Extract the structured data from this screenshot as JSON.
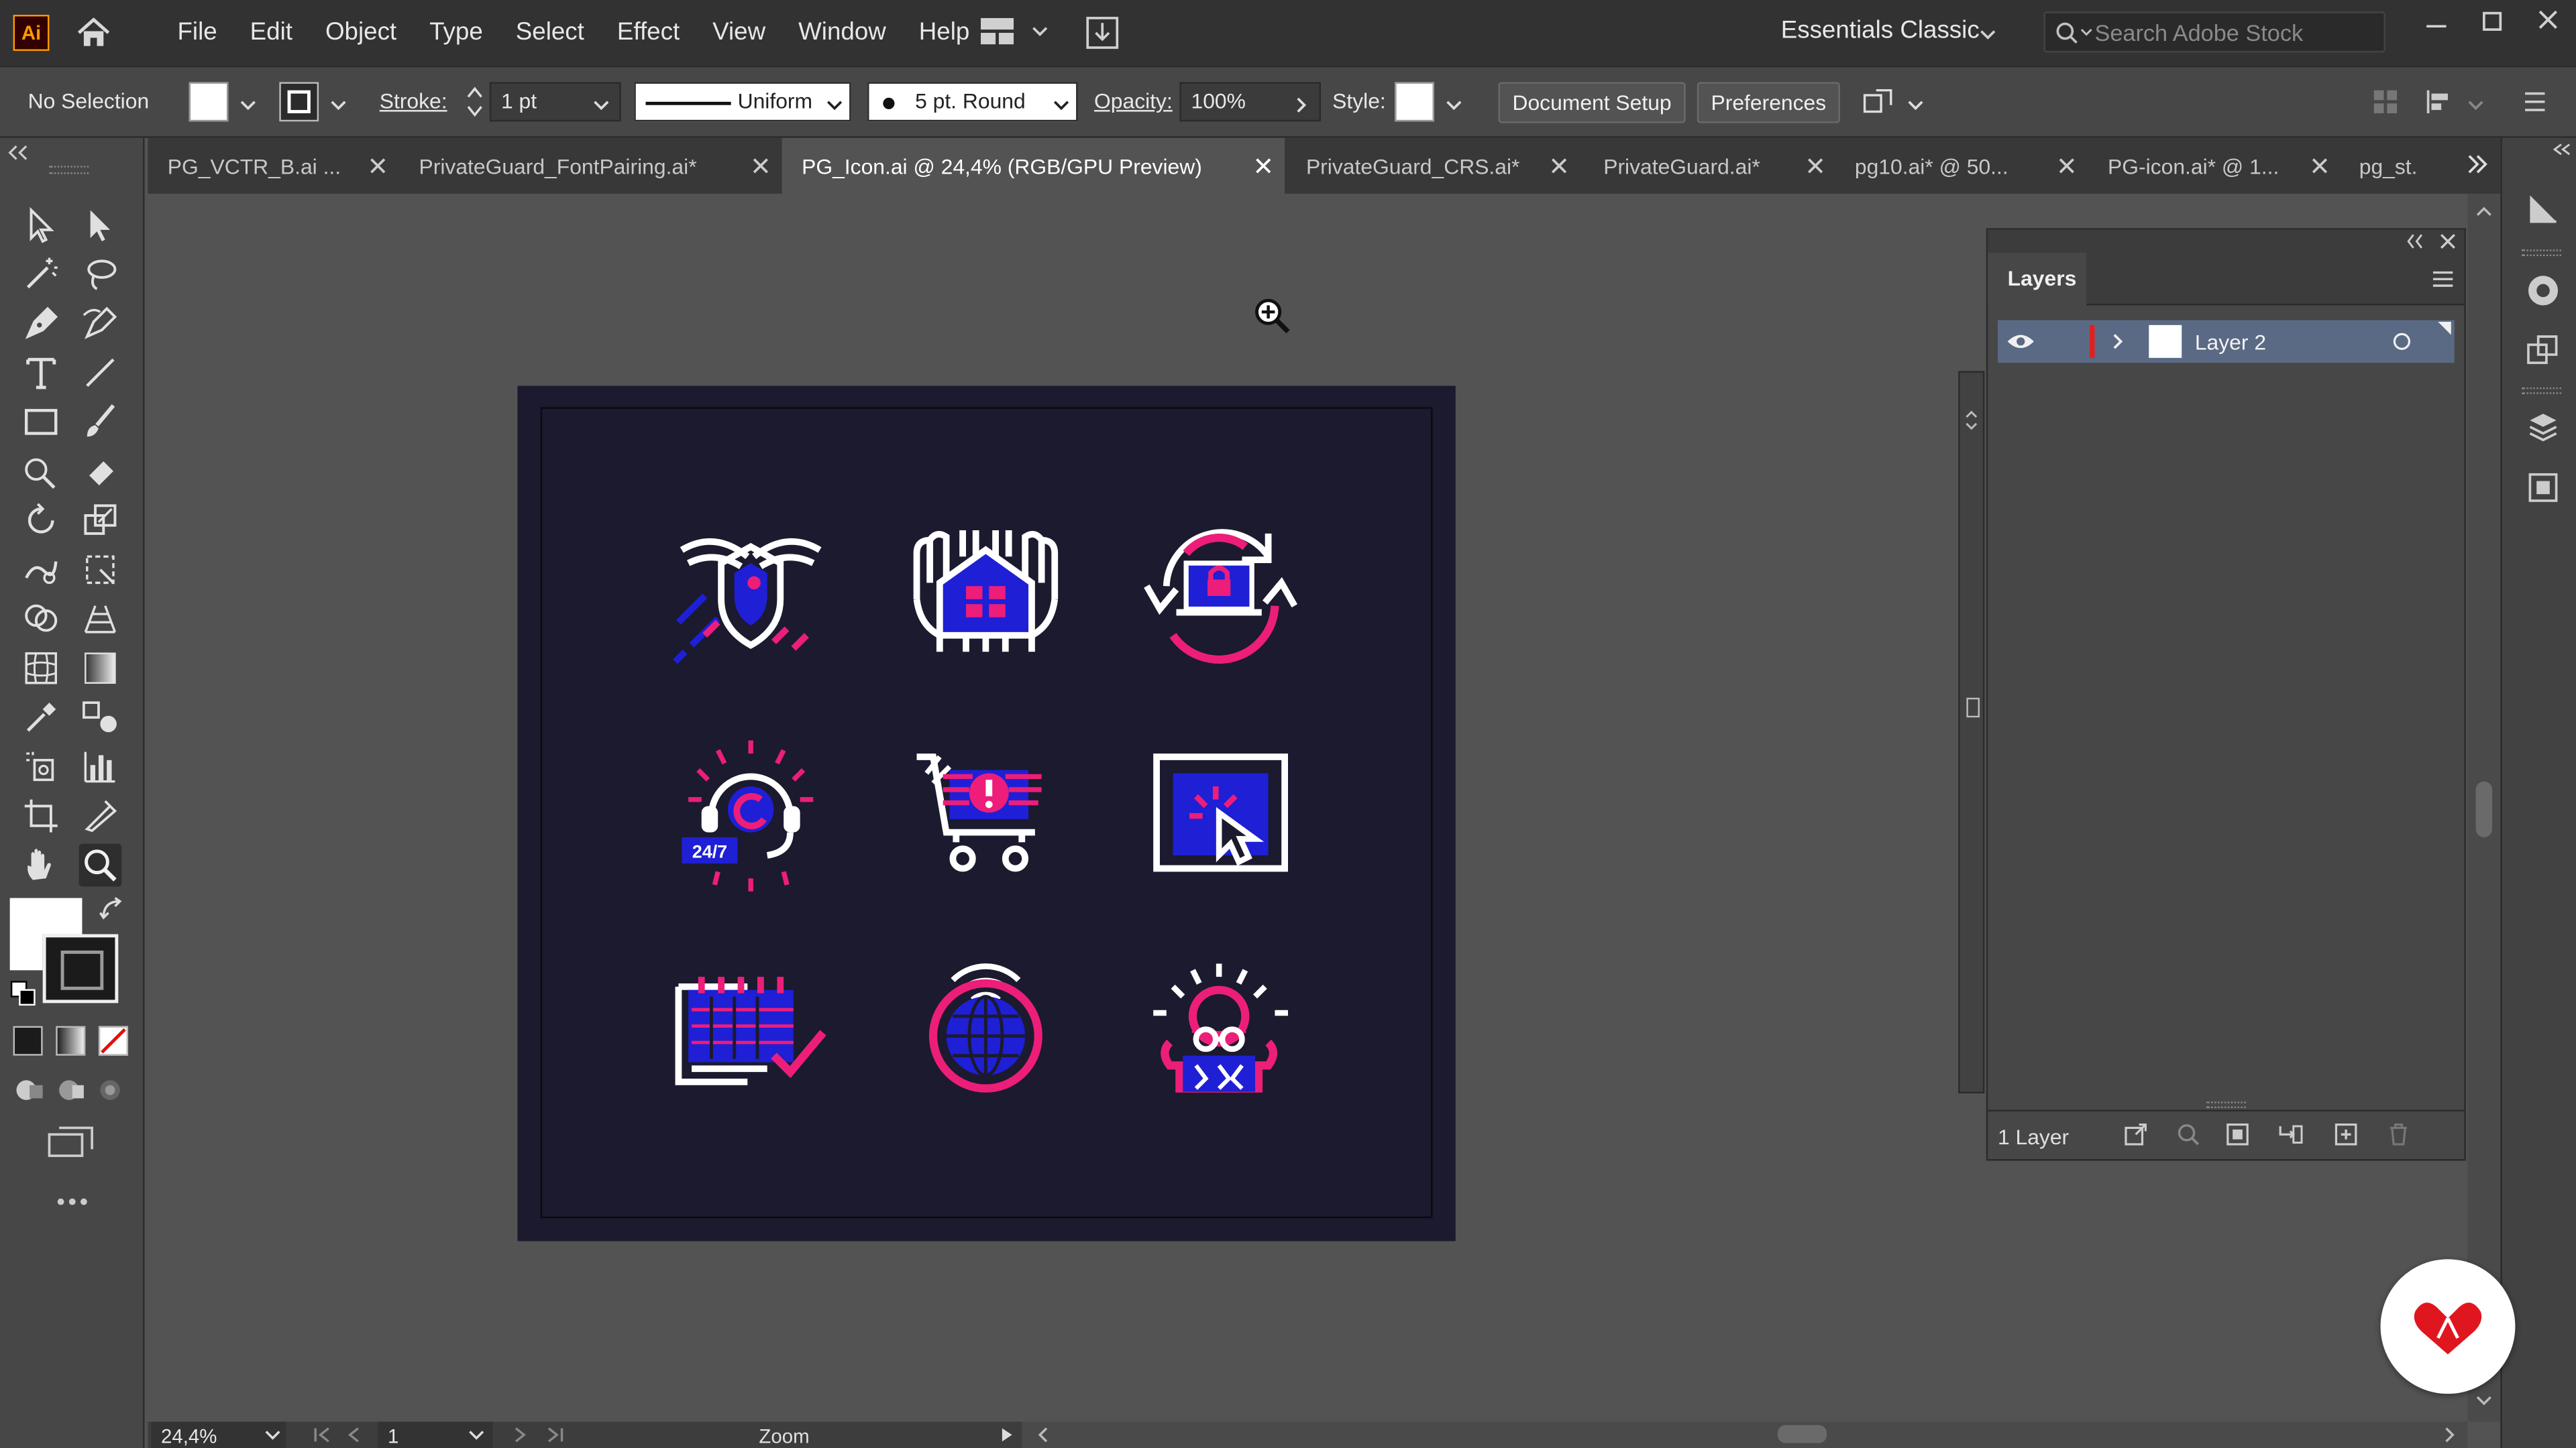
{
  "app": {
    "logo": "Ai"
  },
  "menu": {
    "items": [
      "File",
      "Edit",
      "Object",
      "Type",
      "Select",
      "Effect",
      "View",
      "Window",
      "Help"
    ]
  },
  "workspace": {
    "label": "Essentials Classic"
  },
  "search": {
    "placeholder": "Search Adobe Stock"
  },
  "control_bar": {
    "selection": "No Selection",
    "stroke_label": "Stroke:",
    "stroke_value": "1 pt",
    "profile": "Uniform",
    "brush": "5 pt. Round",
    "opacity_label": "Opacity:",
    "opacity_value": "100%",
    "style_label": "Style:",
    "document_setup": "Document Setup",
    "preferences": "Preferences"
  },
  "tabs": [
    {
      "label": "PG_VCTR_B.ai ...",
      "active": false
    },
    {
      "label": "PrivateGuard_FontPairing.ai*",
      "active": false
    },
    {
      "label": "PG_Icon.ai @ 24,4% (RGB/GPU Preview)",
      "active": true
    },
    {
      "label": "PrivateGuard_CRS.ai*",
      "active": false
    },
    {
      "label": "PrivateGuard.ai*",
      "active": false
    },
    {
      "label": "pg10.ai* @ 50...",
      "active": false
    },
    {
      "label": "PG-icon.ai* @ 1...",
      "active": false
    },
    {
      "label": "pg_st.",
      "active": false
    }
  ],
  "artwork": {
    "icons": [
      "winged-shield-icon",
      "hands-house-icon",
      "sync-lock-icon",
      "support-headset-icon",
      "cart-alert-icon",
      "screen-cursor-icon",
      "calendar-check-icon",
      "global-signal-icon",
      "hacker-alert-icon"
    ],
    "support_label": "24/7",
    "colors": {
      "artboard": "#1b1a2e",
      "blue": "#1f1fd6",
      "pink": "#ec1e79",
      "white": "#ffffff"
    }
  },
  "layers_panel": {
    "title": "Layers",
    "layers": [
      {
        "name": "Layer 2",
        "color": "#e02020"
      }
    ],
    "footer_count": "1 Layer"
  },
  "status": {
    "zoom": "24,4%",
    "artboard": "1",
    "tool": "Zoom"
  }
}
